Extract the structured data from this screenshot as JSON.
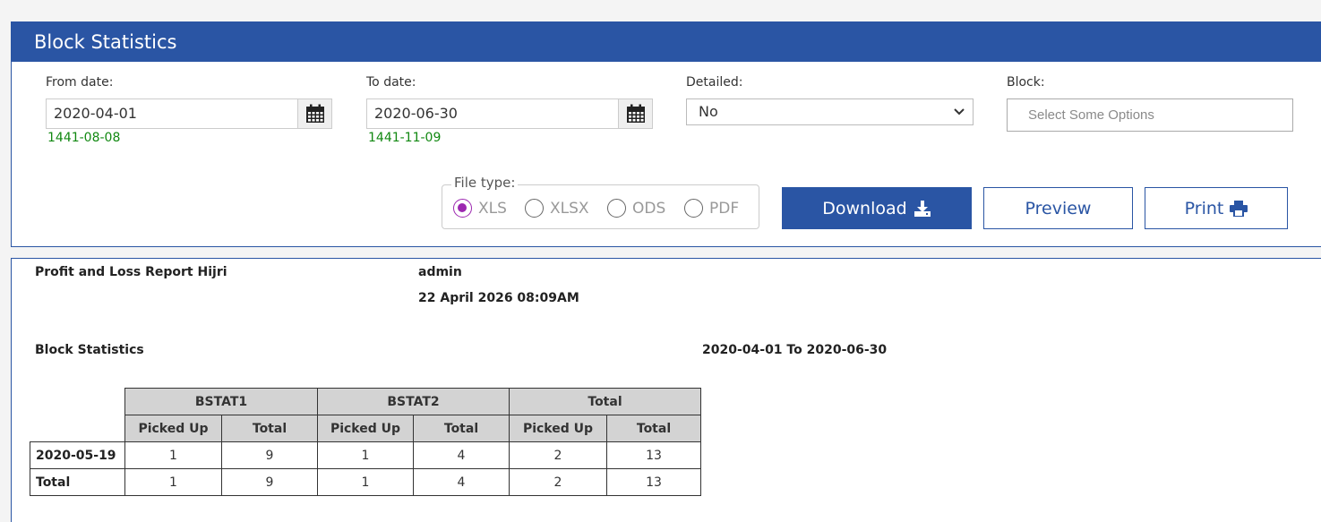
{
  "header": {
    "title": "Block Statistics"
  },
  "filters": {
    "from_date": {
      "label": "From date:",
      "value": "2020-04-01",
      "hijri": "1441-08-08"
    },
    "to_date": {
      "label": "To date:",
      "value": "2020-06-30",
      "hijri": "1441-11-09"
    },
    "detailed": {
      "label": "Detailed:",
      "value": "No"
    },
    "block": {
      "label": "Block:",
      "placeholder": "Select Some Options"
    }
  },
  "file_type": {
    "legend": "File type:",
    "options": [
      "XLS",
      "XLSX",
      "ODS",
      "PDF"
    ],
    "selected": "XLS"
  },
  "actions": {
    "download_label": "Download",
    "preview_label": "Preview",
    "print_label": "Print"
  },
  "report": {
    "report_name": "Profit and Loss Report Hijri",
    "user": "admin",
    "generated_at": "22 April 2026 08:09AM",
    "section_title": "Block Statistics",
    "date_range": "2020-04-01 To 2020-06-30",
    "table": {
      "groups": [
        "BSTAT1",
        "BSTAT2",
        "Total"
      ],
      "subheaders": [
        "Picked Up",
        "Total"
      ],
      "rows": [
        {
          "label": "2020-05-19",
          "values": [
            "1",
            "9",
            "1",
            "4",
            "2",
            "13"
          ]
        },
        {
          "label": "Total",
          "values": [
            "1",
            "9",
            "1",
            "4",
            "2",
            "13"
          ]
        }
      ]
    }
  },
  "colors": {
    "primary": "#2a55a4",
    "hijri_text": "#118811",
    "radio_checked": "#9c27b0",
    "table_header_bg": "#d3d3d3"
  }
}
